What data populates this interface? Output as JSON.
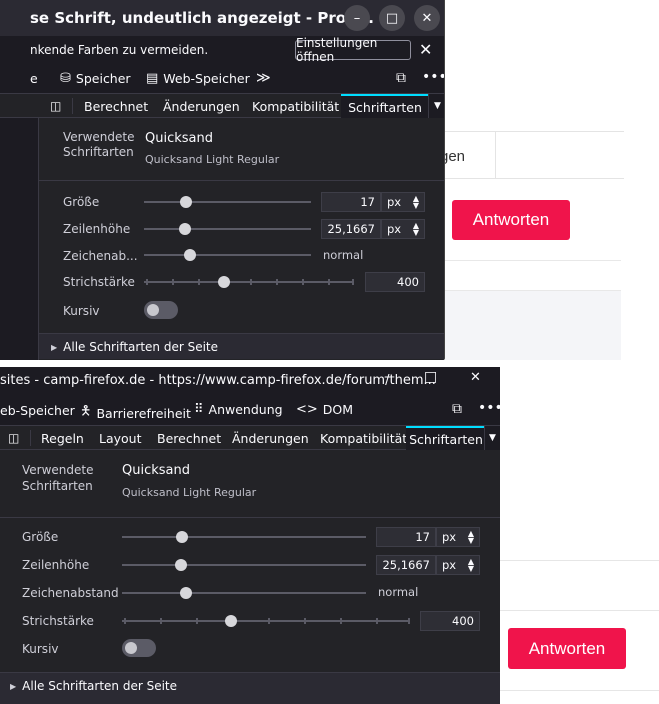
{
  "background": {
    "table_cell_text": "gen",
    "reply_button": "Antworten"
  },
  "window1": {
    "title": "se Schrift, undeutlich angezeigt - Prob...",
    "controls": {
      "minimize": "–",
      "maximize": "□",
      "close": "✕"
    },
    "notification": {
      "text": "nkende Farben zu vermeiden.",
      "button": "Einstellungen öffnen",
      "close": "✕"
    },
    "toolbar": {
      "partial_item": "e",
      "storage": "Speicher",
      "web_storage": "Web-Speicher",
      "more": "≫"
    },
    "tabs": [
      "Berechnet",
      "Änderungen",
      "Kompatibilität",
      "Schriftarten"
    ],
    "panel": {
      "used_fonts_label": "Verwendete Schriftarten",
      "font_name": "Quicksand",
      "font_sub": "Quicksand Light Regular",
      "size_label": "Größe",
      "size_value": "17",
      "size_unit": "px",
      "line_height_label": "Zeilenhöhe",
      "line_height_value": "25,1667",
      "line_height_unit": "px",
      "letter_spacing_label": "Zeichenab...",
      "letter_spacing_value": "normal",
      "weight_label": "Strichstärke",
      "weight_value": "400",
      "italic_label": "Kursiv",
      "footer": "Alle Schriftarten der Seite"
    }
  },
  "window2": {
    "title": "sites - camp-firefox.de - https://www.camp-firefox.de/forum/them...",
    "controls": {
      "minimize": "–",
      "maximize": "□",
      "close": "✕"
    },
    "toolbar": {
      "web_storage": "eb-Speicher",
      "accessibility": "Barrierefreiheit",
      "application": "Anwendung",
      "dom": "DOM"
    },
    "tabs": [
      "Regeln",
      "Layout",
      "Berechnet",
      "Änderungen",
      "Kompatibilität",
      "Schriftarten"
    ],
    "panel": {
      "used_fonts_label": "Verwendete Schriftarten",
      "font_name": "Quicksand",
      "font_sub": "Quicksand Light Regular",
      "size_label": "Größe",
      "size_value": "17",
      "size_unit": "px",
      "line_height_label": "Zeilenhöhe",
      "line_height_value": "25,1667",
      "line_height_unit": "px",
      "letter_spacing_label": "Zeichenabstand",
      "letter_spacing_value": "normal",
      "weight_label": "Strichstärke",
      "weight_value": "400",
      "italic_label": "Kursiv",
      "footer": "Alle Schriftarten der Seite"
    }
  },
  "icons": {
    "storage": "storage-icon",
    "web_storage": "web-storage-icon",
    "accessibility": "accessibility-icon",
    "application": "application-grid-icon",
    "dom": "dom-brackets-icon",
    "responsive": "responsive-design-icon",
    "menu": "overflow-menu-icon"
  },
  "colors": {
    "accent": "#00ddff",
    "reply": "#f0144b",
    "devtools_bg": "#1c1b22",
    "panel_bg": "#232327"
  }
}
